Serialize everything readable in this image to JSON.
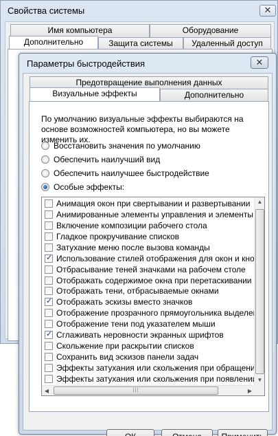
{
  "outer": {
    "title": "Свойства системы",
    "close_glyph": "✕",
    "tabs_top": [
      "Имя компьютера",
      "Оборудование"
    ],
    "tabs_bottom": [
      "Дополнительно",
      "Защита системы",
      "Удаленный доступ"
    ]
  },
  "perf": {
    "title": "Параметры быстродействия",
    "close_glyph": "✕",
    "tabs_top": [
      "Предотвращение выполнения данных"
    ],
    "tabs_bottom": [
      "Визуальные эффекты",
      "Дополнительно"
    ],
    "description": "По умолчанию визуальные эффекты выбираются на основе возможностей компьютера, но вы можете изменить их.",
    "radios": [
      {
        "label": "Восстановить значения по умолчанию",
        "selected": false
      },
      {
        "label": "Обеспечить наилучший вид",
        "selected": false
      },
      {
        "label": "Обеспечить наилучшее быстродействие",
        "selected": false
      },
      {
        "label": "Особые эффекты:",
        "selected": true
      }
    ],
    "effects": [
      {
        "label": "Анимация окон при свертывании и развертывании",
        "checked": false
      },
      {
        "label": "Анимированные элементы управления и элементы вну",
        "checked": false
      },
      {
        "label": "Включение композиции рабочего стола",
        "checked": false
      },
      {
        "label": "Гладкое прокручивание списков",
        "checked": false
      },
      {
        "label": "Затухание меню после вызова команды",
        "checked": false
      },
      {
        "label": "Использование стилей отображения для окон и кнопок",
        "checked": true
      },
      {
        "label": "Отбрасывание теней значками на рабочем столе",
        "checked": false
      },
      {
        "label": "Отображать содержимое окна при перетаскивании",
        "checked": false
      },
      {
        "label": "Отображать тени, отбрасываемые окнами",
        "checked": false
      },
      {
        "label": "Отображать эскизы вместо значков",
        "checked": true
      },
      {
        "label": "Отображение прозрачного прямоугольника выделения",
        "checked": false
      },
      {
        "label": "Отображение тени под указателем мыши",
        "checked": false
      },
      {
        "label": "Сглаживать неровности экранных шрифтов",
        "checked": true
      },
      {
        "label": "Скольжение при раскрытии списков",
        "checked": false
      },
      {
        "label": "Сохранить вид эскизов панели задач",
        "checked": false
      },
      {
        "label": "Эффекты затухания или скольжения при обращении к",
        "checked": false
      },
      {
        "label": "Эффекты затухания или скольжения при появлении по",
        "checked": false
      }
    ],
    "buttons": {
      "ok": "ОК",
      "cancel": "Отмена",
      "apply": "Применить"
    }
  }
}
